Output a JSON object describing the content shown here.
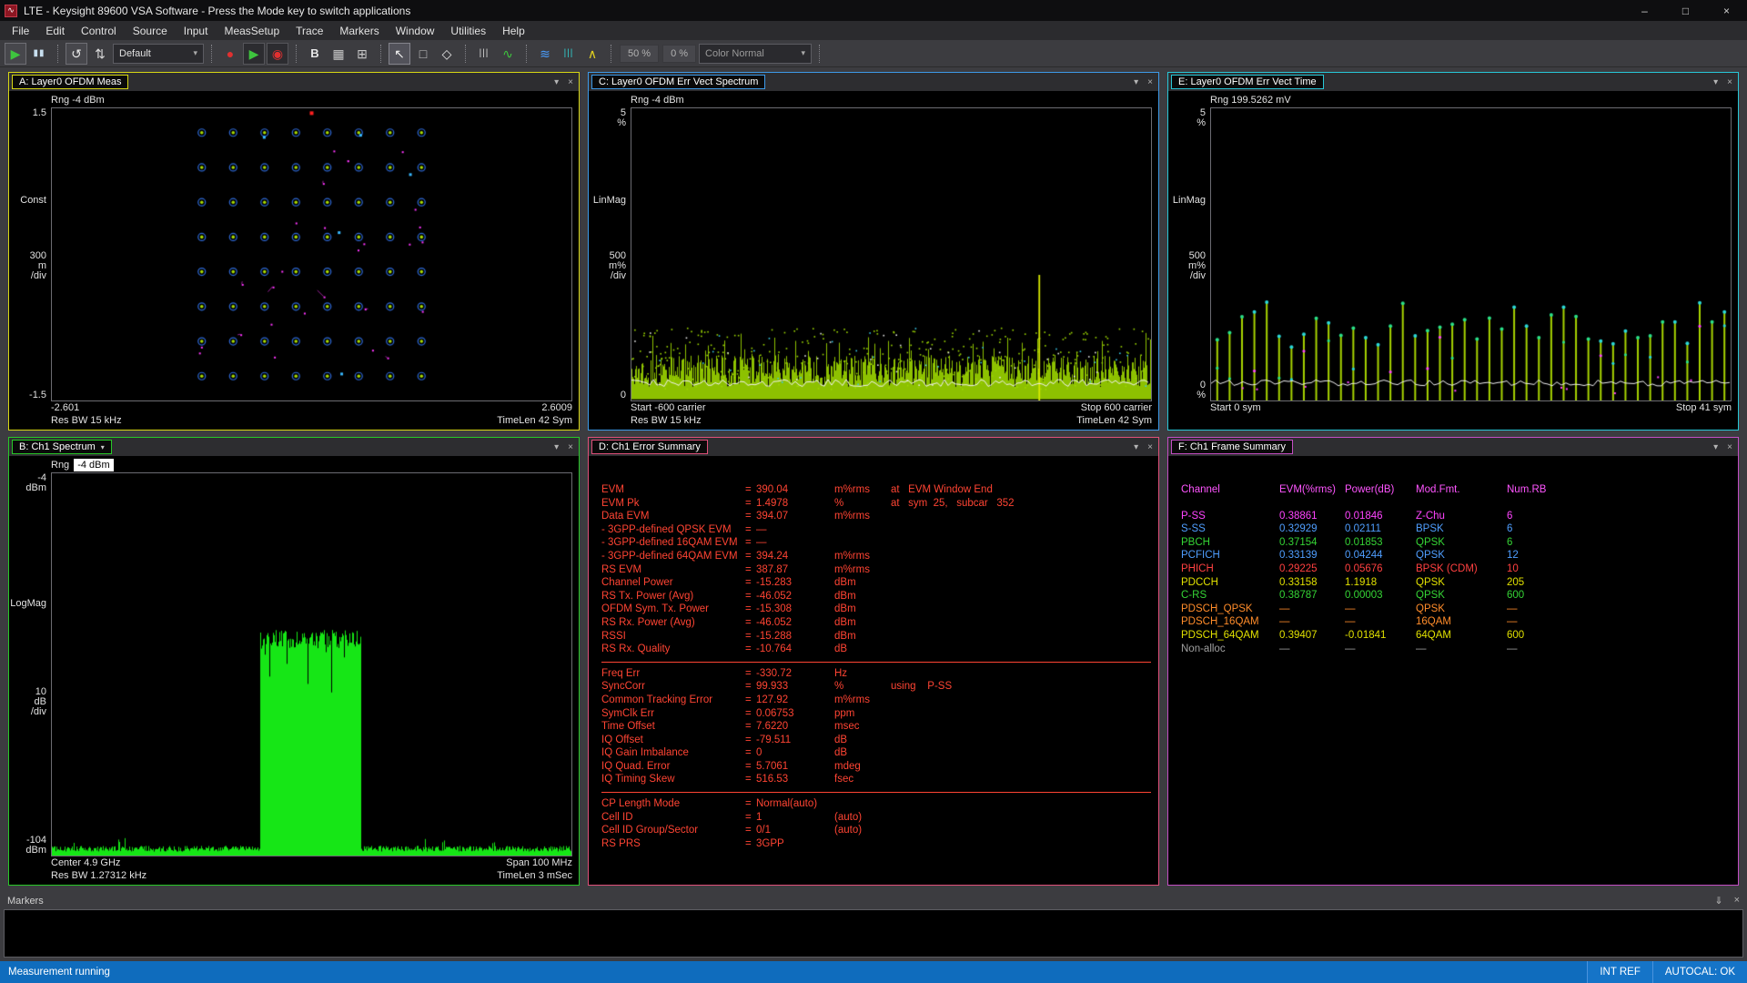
{
  "icons": {
    "caret": "▾",
    "close": "×",
    "pin": "⇓",
    "minimize": "–",
    "maximize": "□",
    "app_glyph": "∿",
    "dd_caret": "▾"
  },
  "window": {
    "title": "LTE - Keysight 89600 VSA Software - Press the Mode key to switch applications"
  },
  "menu": {
    "items": [
      "File",
      "Edit",
      "Control",
      "Source",
      "Input",
      "MeasSetup",
      "Trace",
      "Markers",
      "Window",
      "Utilities",
      "Help"
    ]
  },
  "toolbar": {
    "items": [
      {
        "type": "btn",
        "name": "play-button",
        "glyph": "▶",
        "color": "#3ec43e",
        "box": "outline"
      },
      {
        "type": "btn",
        "name": "pause-button",
        "glyph": "▮▮",
        "color": "#c8dff0",
        "cls": "small"
      },
      {
        "type": "sep"
      },
      {
        "type": "btn",
        "name": "restart-button",
        "glyph": "↺",
        "color": "#e8e8e8",
        "box": "outline"
      },
      {
        "type": "btn",
        "name": "autoscale-button",
        "glyph": "⇅",
        "color": "#d8d8d8"
      },
      {
        "type": "dd",
        "name": "preset-dropdown",
        "label": "Default",
        "width": 100
      },
      {
        "type": "sep"
      },
      {
        "type": "btn",
        "name": "record-button",
        "glyph": "●",
        "color": "#e03030"
      },
      {
        "type": "btn",
        "name": "playback-button",
        "glyph": "▶",
        "color": "#3ec43e",
        "box": "dark"
      },
      {
        "type": "btn",
        "name": "record-setup-button",
        "glyph": "◉",
        "color": "#e03030",
        "box": "dark"
      },
      {
        "type": "sep"
      },
      {
        "type": "btn",
        "name": "format-b-button",
        "glyph": "B",
        "color": "#e8e8e8",
        "cls": "bold"
      },
      {
        "type": "btn",
        "name": "grid-layout-button",
        "glyph": "▦",
        "color": "#c8c8c8"
      },
      {
        "type": "btn",
        "name": "stack-layout-button",
        "glyph": "⊞",
        "color": "#c8c8c8"
      },
      {
        "type": "sep"
      },
      {
        "type": "btn",
        "name": "pointer-button",
        "glyph": "↖",
        "color": "#f0f0f0",
        "box": "active"
      },
      {
        "type": "btn",
        "name": "zoom-select-button",
        "glyph": "□",
        "color": "#c8c8c8"
      },
      {
        "type": "btn",
        "name": "marker-diamond-button",
        "glyph": "◇",
        "color": "#e8e8e8"
      },
      {
        "type": "sep"
      },
      {
        "type": "btn",
        "name": "cursor-lines-button",
        "glyph": "|||",
        "color": "#d8d8d8",
        "cls": "small"
      },
      {
        "type": "btn",
        "name": "peak-marker-button",
        "glyph": "∿",
        "color": "#3ec43e"
      },
      {
        "type": "sep"
      },
      {
        "type": "btn",
        "name": "spectrogram-button",
        "glyph": "≋",
        "color": "#4a9eff"
      },
      {
        "type": "btn",
        "name": "bar-display-button",
        "glyph": "|||",
        "color": "#30d0d0",
        "cls": "small"
      },
      {
        "type": "btn",
        "name": "peak-hold-button",
        "glyph": "∧",
        "color": "#e0d020"
      },
      {
        "type": "sep"
      },
      {
        "type": "text",
        "name": "overlap-percent",
        "label": "50 %"
      },
      {
        "type": "text",
        "name": "frame-percent",
        "label": "0 %"
      },
      {
        "type": "dd",
        "name": "color-mode-dropdown",
        "label": "Color Normal",
        "width": 124,
        "muted": true
      },
      {
        "type": "sep"
      }
    ]
  },
  "panels": {
    "a": {
      "title": "A: Layer0 OFDM Meas",
      "accent": "#d8d814",
      "rng": "Rng -4 dBm",
      "y_top": "1.5",
      "y_name": "Const",
      "y_div": "300\nm\n/div",
      "y_bottom": "-1.5",
      "x_left": "-2.601",
      "x_right": "2.6009",
      "info_left": "Res BW 15 kHz",
      "info_right": "TimeLen 42  Sym"
    },
    "c": {
      "title": "C: Layer0 OFDM Err Vect Spectrum",
      "accent": "#3d9ae8",
      "rng": "Rng -4 dBm",
      "y_top": "5\n%",
      "y_name": "LinMag",
      "y_div": "500\nm%\n/div",
      "y_bottom": "0",
      "x_left": "Start -600  carrier",
      "x_right": "Stop 600  carrier",
      "info_left": "Res BW 15 kHz",
      "info_right": "TimeLen 42  Sym"
    },
    "e": {
      "title": "E: Layer0 OFDM Err Vect Time",
      "accent": "#28c8d8",
      "rng": "Rng 199.5262 mV",
      "y_top": "5\n%",
      "y_name": "LinMag",
      "y_div": "500\nm%\n/div",
      "y_bottom": "0\n%",
      "x_left": "Start 0  sym",
      "x_right": "Stop 41  sym",
      "info_left": "",
      "info_right": ""
    },
    "b": {
      "title": "B: Ch1 Spectrum",
      "accent": "#28c828",
      "rng_label": "Rng",
      "rng_value": "-4 dBm",
      "y_top": "-4\ndBm",
      "y_name": "LogMag",
      "y_div": "10\ndB\n/div",
      "y_bottom": "-104\ndBm",
      "x_left": "Center 4.9 GHz",
      "x_right": "Span 100 MHz",
      "info_left": "Res BW 1.27312 kHz",
      "info_right": "TimeLen 3 mSec"
    }
  },
  "error_summary": {
    "title": "D: Ch1 Error Summary",
    "accent": "#e0507a",
    "text_color": "#ff4433",
    "sections": [
      {
        "rows": [
          {
            "label": "EVM",
            "value": "390.04",
            "unit": "m%rms",
            "note": "at   EVM Window End"
          },
          {
            "label": "EVM Pk",
            "value": "1.4978",
            "unit": "%",
            "note": "at   sym  25,   subcar   352"
          },
          {
            "label": "Data EVM",
            "value": "394.07",
            "unit": "m%rms",
            "note": ""
          },
          {
            "label": "- 3GPP-defined QPSK EVM",
            "value": "—",
            "unit": "",
            "note": ""
          },
          {
            "label": "- 3GPP-defined 16QAM EVM",
            "value": "—",
            "unit": "",
            "note": ""
          },
          {
            "label": "- 3GPP-defined 64QAM EVM",
            "value": "394.24",
            "unit": "m%rms",
            "note": ""
          },
          {
            "label": "RS EVM",
            "value": "387.87",
            "unit": "m%rms",
            "note": ""
          },
          {
            "label": "Channel Power",
            "value": "-15.283",
            "unit": "dBm",
            "note": ""
          },
          {
            "label": "RS Tx. Power (Avg)",
            "value": "-46.052",
            "unit": "dBm",
            "note": ""
          },
          {
            "label": "OFDM Sym. Tx. Power",
            "value": "-15.308",
            "unit": "dBm",
            "note": ""
          },
          {
            "label": "RS Rx. Power (Avg)",
            "value": "-46.052",
            "unit": "dBm",
            "note": ""
          },
          {
            "label": "RSSI",
            "value": "-15.288",
            "unit": "dBm",
            "note": ""
          },
          {
            "label": "RS Rx. Quality",
            "value": "-10.764",
            "unit": "dB",
            "note": ""
          }
        ]
      },
      {
        "rows": [
          {
            "label": "Freq Err",
            "value": "-330.72",
            "unit": "Hz",
            "note": ""
          },
          {
            "label": "SyncCorr",
            "value": "99.933",
            "unit": "%",
            "note": "using    P-SS"
          },
          {
            "label": "Common Tracking Error",
            "value": "127.92",
            "unit": "m%rms",
            "note": ""
          },
          {
            "label": "SymClk Err",
            "value": "0.06753",
            "unit": "ppm",
            "note": ""
          },
          {
            "label": "Time Offset",
            "value": "7.6220",
            "unit": "msec",
            "note": ""
          },
          {
            "label": "IQ Offset",
            "value": "-79.511",
            "unit": "dB",
            "note": ""
          },
          {
            "label": "IQ Gain Imbalance",
            "value": "0",
            "unit": "dB",
            "note": ""
          },
          {
            "label": "IQ Quad. Error",
            "value": "5.7061",
            "unit": "mdeg",
            "note": ""
          },
          {
            "label": "IQ Timing Skew",
            "value": "516.53",
            "unit": "fsec",
            "note": ""
          }
        ]
      },
      {
        "rows": [
          {
            "label": "CP Length Mode",
            "value": "Normal(auto)",
            "unit": "",
            "note": ""
          },
          {
            "label": "Cell ID",
            "value": "1",
            "unit": "(auto)",
            "note": ""
          },
          {
            "label": "Cell ID Group/Sector",
            "value": "0/1",
            "unit": "(auto)",
            "note": ""
          },
          {
            "label": "RS PRS",
            "value": "3GPP",
            "unit": "",
            "note": ""
          }
        ]
      }
    ]
  },
  "frame_summary": {
    "title": "F: Ch1 Frame Summary",
    "accent": "#c44ec4",
    "header_color": "#ff55ff",
    "columns": [
      "Channel",
      "EVM(%rms)",
      "Power(dB)",
      "Mod.Fmt.",
      "Num.RB"
    ],
    "rows": [
      {
        "color": "#ff44ff",
        "cells": [
          "P-SS",
          "0.38861",
          "0.01846",
          "Z-Chu",
          "6"
        ]
      },
      {
        "color": "#4f9eff",
        "cells": [
          "S-SS",
          "0.32929",
          "0.02111",
          "BPSK",
          "6"
        ]
      },
      {
        "color": "#35d435",
        "cells": [
          "PBCH",
          "0.37154",
          "0.01853",
          "QPSK",
          "6"
        ]
      },
      {
        "color": "#4f9eff",
        "cells": [
          "PCFICH",
          "0.33139",
          "0.04244",
          "QPSK",
          "12"
        ]
      },
      {
        "color": "#ff4040",
        "cells": [
          "PHICH",
          "0.29225",
          "0.05676",
          "BPSK (CDM)",
          "10"
        ]
      },
      {
        "color": "#e0e000",
        "cells": [
          "PDCCH",
          "0.33158",
          "1.1918",
          "QPSK",
          "205"
        ]
      },
      {
        "color": "#35d435",
        "cells": [
          "C-RS",
          "0.38787",
          "0.00003",
          "QPSK",
          "600"
        ]
      },
      {
        "color": "#ff8c2a",
        "cells": [
          "PDSCH_QPSK",
          "—",
          "—",
          "QPSK",
          "—"
        ]
      },
      {
        "color": "#ff8c2a",
        "cells": [
          "PDSCH_16QAM",
          "—",
          "—",
          "16QAM",
          "—"
        ]
      },
      {
        "color": "#e0e000",
        "cells": [
          "PDSCH_64QAM",
          "0.39407",
          "-0.01841",
          "64QAM",
          "600"
        ]
      },
      {
        "color": "#a0a0a0",
        "cells": [
          "Non-alloc",
          "—",
          "—",
          "—",
          "—"
        ]
      }
    ]
  },
  "markers": {
    "title": "Markers"
  },
  "status": {
    "left": "Measurement running",
    "int_ref": "INT REF",
    "autocal": "AUTOCAL: OK"
  },
  "chart_data": [
    {
      "id": "plot-a",
      "type": "constellation",
      "panel": "A: Layer0 OFDM Meas",
      "trace": "64QAM constellation",
      "xlim": [
        -2.601,
        2.6009
      ],
      "ylim": [
        -1.5,
        1.5
      ],
      "y_per_div": "300 m",
      "ideal_grid": {
        "cols": 8,
        "rows": 8,
        "x_extent": [
          -1.1,
          1.1
        ],
        "y_extent": [
          -1.25,
          1.25
        ]
      },
      "error_points": 26,
      "blue_points": 5,
      "reference_point": {
        "x": 0.0,
        "y": 1.45
      },
      "res_bw": "15 kHz",
      "time_len": "42 Sym"
    },
    {
      "id": "plot-c",
      "type": "evm_spectrum",
      "panel": "C: Layer0 OFDM Err Vect Spectrum",
      "ylabel": "LinMag",
      "ylim": [
        0,
        5
      ],
      "unit": "%",
      "x_start": -600,
      "x_stop": 600,
      "x_unit": "carrier",
      "noise_band": [
        0.05,
        1.0
      ],
      "avg_line": 0.3,
      "spike": {
        "x_frac": 0.785,
        "height": 2.15
      },
      "res_bw": "15 kHz",
      "time_len": "42 Sym"
    },
    {
      "id": "plot-e",
      "type": "evm_time",
      "panel": "E: Layer0 OFDM Err Vect Time",
      "ylabel": "LinMag",
      "ylim": [
        0,
        5
      ],
      "unit": "%",
      "x_start": 0,
      "x_stop": 41,
      "x_unit": "sym",
      "symbols": 42,
      "bar_height_range": [
        0.85,
        1.75
      ],
      "avg_line": 0.3
    },
    {
      "id": "plot-b",
      "type": "spectrum",
      "panel": "B: Ch1 Spectrum",
      "ylabel": "LogMag",
      "ylim": [
        -104,
        -4
      ],
      "unit": "dBm",
      "center": "4.9 GHz",
      "span": "100 MHz",
      "signal_band_frac": [
        0.4,
        0.595
      ],
      "signal_top_dbm": -47.5,
      "noise_floor_dbm": -102.5,
      "res_bw": "1.27312 kHz",
      "time_len": "3 mSec"
    }
  ]
}
